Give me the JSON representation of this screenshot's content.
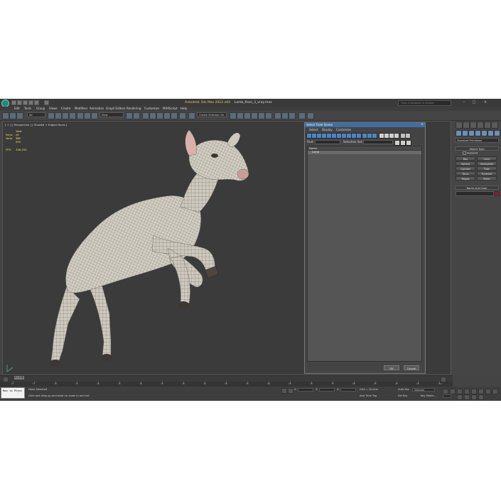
{
  "app": {
    "title": "Autodesk 3ds Max  2012 x64",
    "file_name": "Lamb_Pose_3_vray.max",
    "search_placeholder": "Type a keyword or phrase",
    "menus": [
      "Edit",
      "Tools",
      "Group",
      "Views",
      "Create",
      "Modifiers",
      "Animation",
      "Graph Editors",
      "Rendering",
      "Customize",
      "MAXScript",
      "Help"
    ]
  },
  "toolbar": {
    "selection_filter": "All",
    "reference_coord": "View",
    "named_selection": "Create Selection Se"
  },
  "viewport": {
    "label": "[ + ] [ Perspective ] [ Shaded + Edged Faces ]",
    "stats_header": "Total",
    "polys_label": "Polys:",
    "polys_value": "26 799",
    "verts_label": "Verts:",
    "verts_value": "13 090",
    "fps_label": "FPS:",
    "fps_value": "346.250"
  },
  "dialog": {
    "title": "Select From Scene",
    "menus": [
      "Select",
      "Display",
      "Customize"
    ],
    "find_label": "Find:",
    "selection_set_label": "Selection Set:",
    "column_name": "Name",
    "rows": [
      "Lamb"
    ],
    "ok_label": "OK",
    "cancel_label": "Cancel"
  },
  "command_panel": {
    "category": "Standard Primitives",
    "object_type_title": "Object Type",
    "autogrid_label": "AutoGrid",
    "objects": [
      "Box",
      "Cone",
      "Sphere",
      "GeoSphere",
      "Cylinder",
      "Tube",
      "Torus",
      "Pyramid",
      "Teapot",
      "Plane"
    ],
    "name_color_title": "Name and Color",
    "color": "#8a1c2c"
  },
  "timeline": {
    "frame_label": "0 / 100",
    "ticks": [
      "0",
      "5",
      "10",
      "15",
      "20",
      "25",
      "30",
      "35",
      "40",
      "45",
      "50",
      "55",
      "60",
      "65",
      "70",
      "75",
      "80",
      "85",
      "90",
      "95",
      "100"
    ]
  },
  "status": {
    "maxscript_line1": "Max to Physc",
    "selection_info": "None Selected",
    "prompt": "Click and drag up-and-down to zoom in and out",
    "x_label": "X:",
    "y_label": "Y:",
    "z_label": "Z:",
    "grid_label": "Grid = 10,0cm",
    "auto_key": "Auto Key",
    "auto_key_value": "Selected",
    "set_key": "Set Key",
    "key_filters": "Key Filters...",
    "add_time_tag": "Add Time Tag"
  }
}
